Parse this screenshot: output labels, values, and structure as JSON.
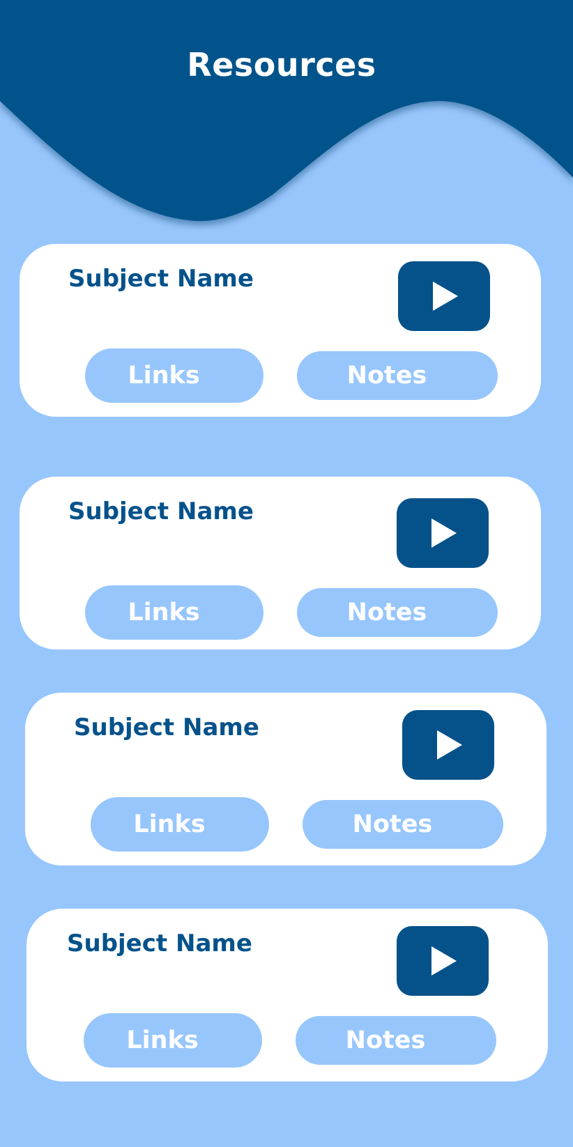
{
  "header": {
    "title": "Resources",
    "background_color": "#05528b"
  },
  "colors": {
    "page_background": "#97c6fd",
    "card_background": "#ffffff",
    "accent": "#05528b",
    "pill": "#97c6fd"
  },
  "cards": [
    {
      "subject": "Subject Name",
      "video_icon": "play-icon",
      "links_label": "Links",
      "notes_label": "Notes"
    },
    {
      "subject": "Subject Name",
      "video_icon": "play-icon",
      "links_label": "Links",
      "notes_label": "Notes"
    },
    {
      "subject": "Subject Name",
      "video_icon": "play-icon",
      "links_label": "Links",
      "notes_label": "Notes"
    },
    {
      "subject": "Subject Name",
      "video_icon": "play-icon",
      "links_label": "Links",
      "notes_label": "Notes"
    }
  ]
}
